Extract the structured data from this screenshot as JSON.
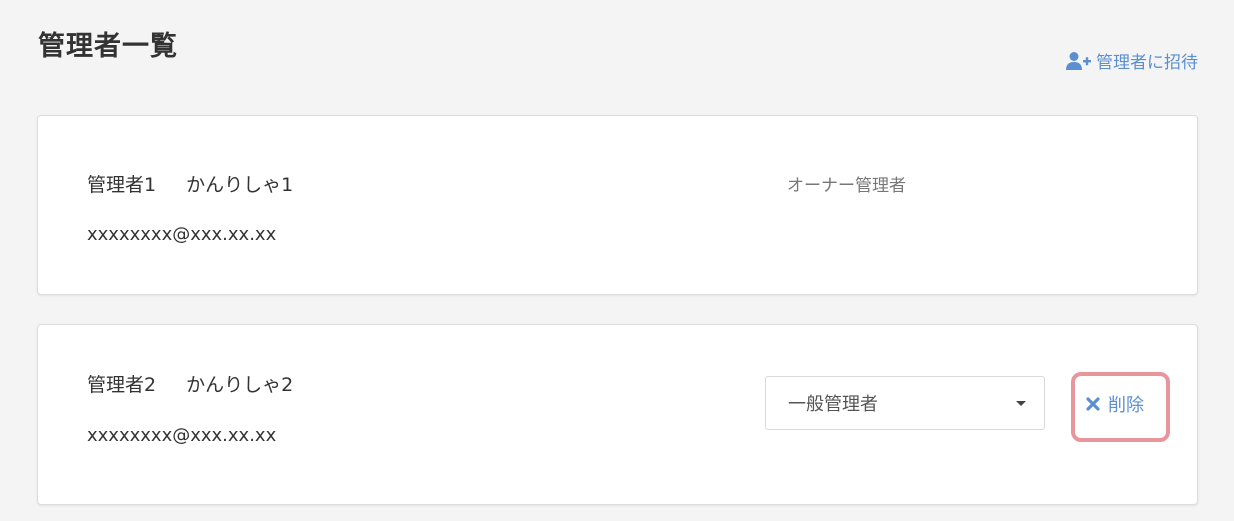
{
  "page": {
    "title": "管理者一覧"
  },
  "header": {
    "invite_label": "管理者に招待",
    "invite_icon": "user-plus-icon"
  },
  "admins": [
    {
      "name": "管理者1",
      "kana": "かんりしゃ1",
      "email": "xxxxxxxx@xxx.xx.xx",
      "role": "オーナー管理者"
    },
    {
      "name": "管理者2",
      "kana": "かんりしゃ2",
      "email": "xxxxxxxx@xxx.xx.xx",
      "role": "一般管理者",
      "delete_label": "削除",
      "delete_icon": "close-icon"
    }
  ],
  "colors": {
    "accent": "#5b8fd0",
    "highlight": "#e8959b",
    "background": "#f4f4f4"
  }
}
